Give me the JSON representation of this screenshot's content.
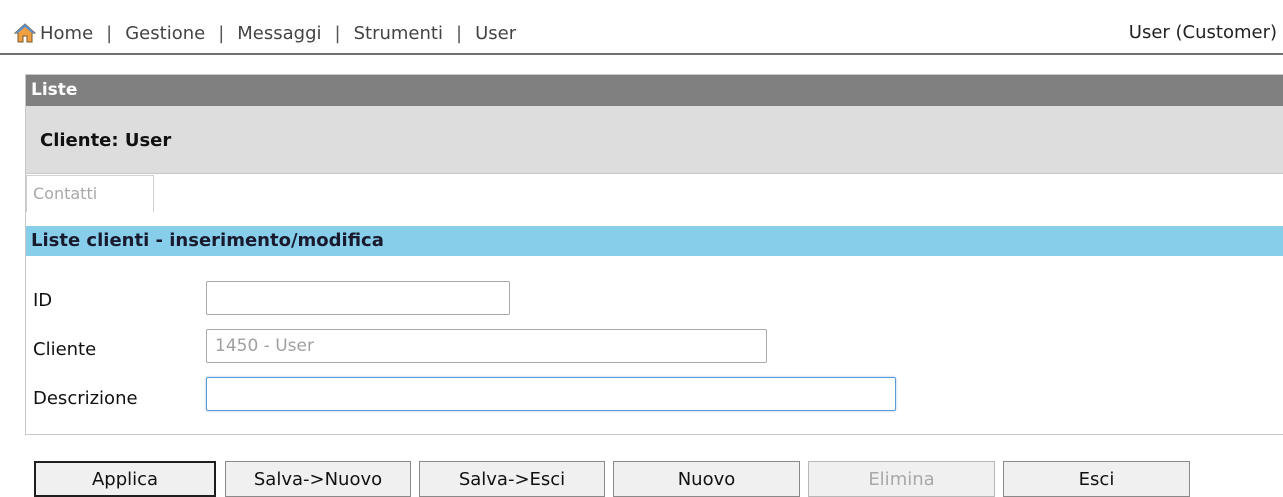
{
  "nav": {
    "items": [
      "Home",
      "Gestione",
      "Messaggi",
      "Strumenti",
      "User"
    ],
    "separator": "|",
    "user_label": "User (Customer)",
    "home_icon": "home-icon"
  },
  "panel": {
    "header": "Liste",
    "cliente_title": "Cliente: User",
    "tab_contatti": "Contatti",
    "section_title": "Liste clienti - inserimento/modifica"
  },
  "form": {
    "id_label": "ID",
    "id_value": "",
    "cliente_label": "Cliente",
    "cliente_placeholder": "1450 - User",
    "descrizione_label": "Descrizione",
    "descrizione_value": ""
  },
  "buttons": {
    "applica": "Applica",
    "salva_nuovo": "Salva->Nuovo",
    "salva_esci": "Salva->Esci",
    "nuovo": "Nuovo",
    "elimina": "Elimina",
    "esci": "Esci"
  },
  "colors": {
    "header_bar": "#808080",
    "cliente_bar": "#dddddd",
    "section_bar": "#87ceeb",
    "disabled_text": "#a8a8a8"
  }
}
